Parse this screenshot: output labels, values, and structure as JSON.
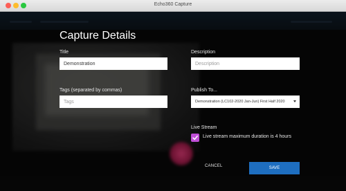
{
  "window": {
    "title": "Echo360 Capture"
  },
  "page": {
    "heading": "Capture Details"
  },
  "form": {
    "title_label": "Title",
    "title_value": "Demonstration",
    "description_label": "Description",
    "description_placeholder": "Description",
    "tags_label": "Tags (separated by commas)",
    "tags_placeholder": "Tags",
    "publish_label": "Publish To...",
    "publish_value": "Demonstration (LC102-2020 Jan-Jun) First Half 2020",
    "live_stream_label": "Live Stream",
    "live_stream_checkbox_label": "Live stream maximum duration is 4 hours",
    "live_stream_checked": true
  },
  "actions": {
    "cancel_label": "CANCEL",
    "save_label": "SAVE"
  },
  "colors": {
    "accent_blue": "#1e6ec0",
    "checkbox_purple": "#c04fd7"
  }
}
